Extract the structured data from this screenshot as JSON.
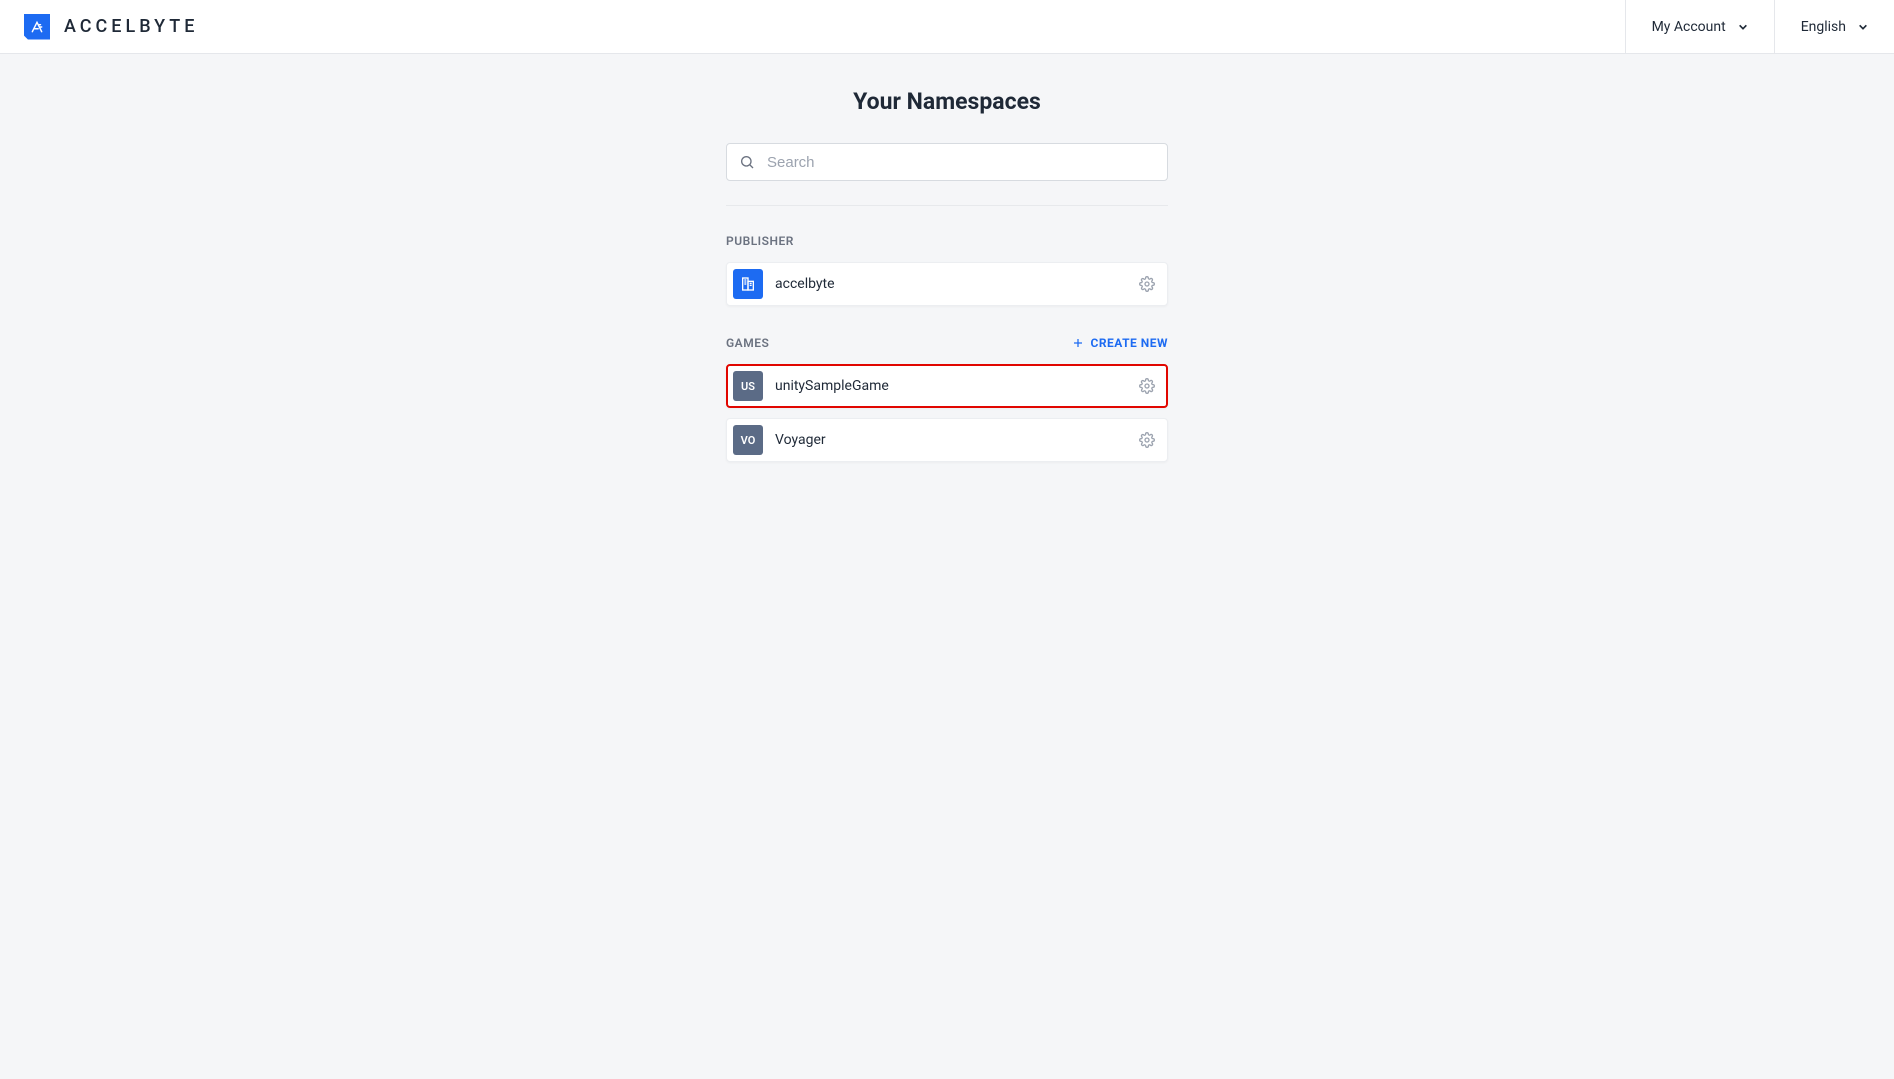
{
  "header": {
    "brand": "ACCELBYTE",
    "account_label": "My Account",
    "language_label": "English"
  },
  "page": {
    "title": "Your Namespaces",
    "search_placeholder": "Search"
  },
  "sections": {
    "publisher": {
      "label": "PUBLISHER",
      "item": {
        "name": "accelbyte"
      }
    },
    "games": {
      "label": "GAMES",
      "create_label": "CREATE NEW",
      "items": [
        {
          "code": "US",
          "name": "unitySampleGame",
          "highlighted": true
        },
        {
          "code": "VO",
          "name": "Voyager",
          "highlighted": false
        }
      ]
    }
  }
}
